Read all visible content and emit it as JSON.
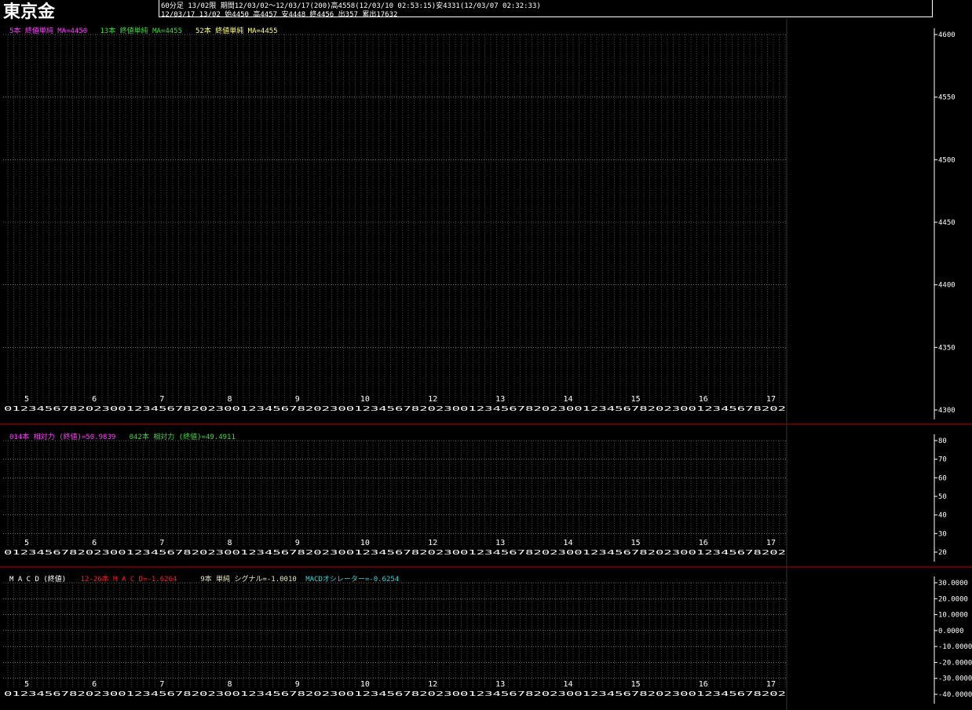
{
  "header": {
    "title": "東京金",
    "line1": "60分足  13/02限  期間12/03/02～12/03/17(200)高4558(12/03/10 02:53:15)安4331(12/03/07 02:32:33)",
    "line2": "12/03/17 13/02 始4450 高4457 安4448 終4456 出357 累出17632"
  },
  "colors": {
    "background": "#000000",
    "grid": "#ffffff",
    "candle": "#ffa828",
    "ma_short": "#ff40ff",
    "ma_mid": "#3cdc3c",
    "ma_long": "#ffff80",
    "rsi_short": "#ff40ff",
    "rsi_long": "#3cdc3c",
    "macd": "#ff2020",
    "signal": "#e8e8c0",
    "histogram": "#40d0d0",
    "separator": "#c00000"
  },
  "legends": {
    "price": [
      {
        "text": "5本  終値単純  MA=4450",
        "color": "#ff40ff"
      },
      {
        "text": "13本  終値単純  MA=4455",
        "color": "#3cdc3c"
      },
      {
        "text": "52本  終値単純  MA=4455",
        "color": "#ffff80"
      }
    ],
    "rsi": [
      {
        "text": "014本  相対力  (終値)=50.9839",
        "color": "#ff40ff"
      },
      {
        "text": "042本  相対力  (終値)=49.4911",
        "color": "#3cdc3c"
      }
    ],
    "macd": [
      {
        "text": "M A C D  (終値)",
        "color": "#ffffff"
      },
      {
        "text": "12-26本  M A C D=-1.6264",
        "color": "#ff2020"
      },
      {
        "text": "9本  単純  シグナル=-1.0010",
        "color": "#e8e8c0"
      },
      {
        "text": "MACDオシレーター=-0.6254",
        "color": "#40d0d0"
      }
    ]
  },
  "date_labels": [
    "5",
    "6",
    "7",
    "8",
    "9",
    "10",
    "12",
    "13",
    "14",
    "15",
    "16",
    "17"
  ],
  "hour_strip": "01234567820230",
  "chart_data": [
    {
      "type": "candlestick",
      "title": "東京金",
      "ylim": [
        4300,
        4600
      ],
      "yticks": [
        4300,
        4350,
        4400,
        4450,
        4500,
        4550,
        4600
      ],
      "last": {
        "open": 4450,
        "high": 4457,
        "low": 4448,
        "close": 4456
      },
      "ma": {
        "5本": 4450,
        "13本": 4455,
        "52本": 4455
      }
    },
    {
      "type": "line",
      "title": "相対力 (終値)",
      "ylim": [
        20,
        80
      ],
      "yticks": [
        20,
        30,
        40,
        50,
        60,
        70,
        80
      ],
      "last": {
        "014本": 50.9839,
        "042本": 49.4911
      }
    },
    {
      "type": "line",
      "title": "M A C D  (終値)",
      "ylim": [
        -40,
        30
      ],
      "yticks": [
        -40,
        -30,
        -20,
        -10,
        0,
        10,
        20,
        30
      ],
      "ytick_labels": [
        "-40.0000",
        "-30.0000",
        "-20.0000",
        "-10.0000",
        "0.0000",
        "10.0000",
        "20.0000",
        "30.0000"
      ],
      "last": {
        "MACD": -1.6264,
        "シグナル": -1.001,
        "MACDオシレーター": -0.6254
      }
    }
  ]
}
